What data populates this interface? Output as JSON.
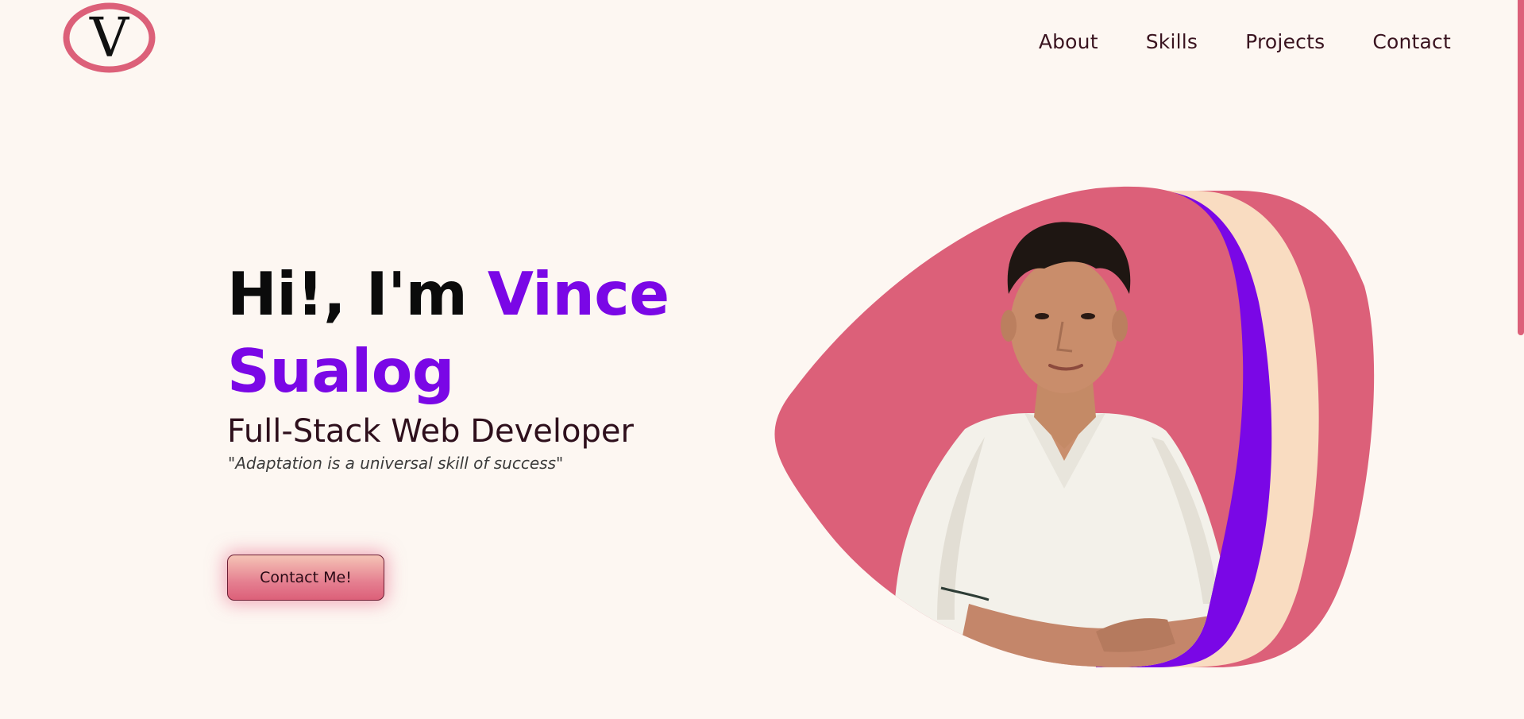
{
  "header": {
    "logo_letter": "V",
    "nav": [
      "About",
      "Skills",
      "Projects",
      "Contact"
    ]
  },
  "hero": {
    "greeting": "Hi!, I'm ",
    "name_first": "Vince",
    "name_last": "Sualog",
    "role": "Full-Stack Web Developer",
    "quote": "\"Adaptation is a universal skill of success\"",
    "cta_label": "Contact Me!"
  },
  "colors": {
    "background": "#fdf7f2",
    "accent_purple": "#7a07e6",
    "accent_pink": "#dc6079",
    "peach": "#f9dcc1",
    "text_dark": "#3a1420"
  },
  "icons": {
    "logo": "v-monogram-oval"
  },
  "image": {
    "subject": "portrait-photo"
  }
}
